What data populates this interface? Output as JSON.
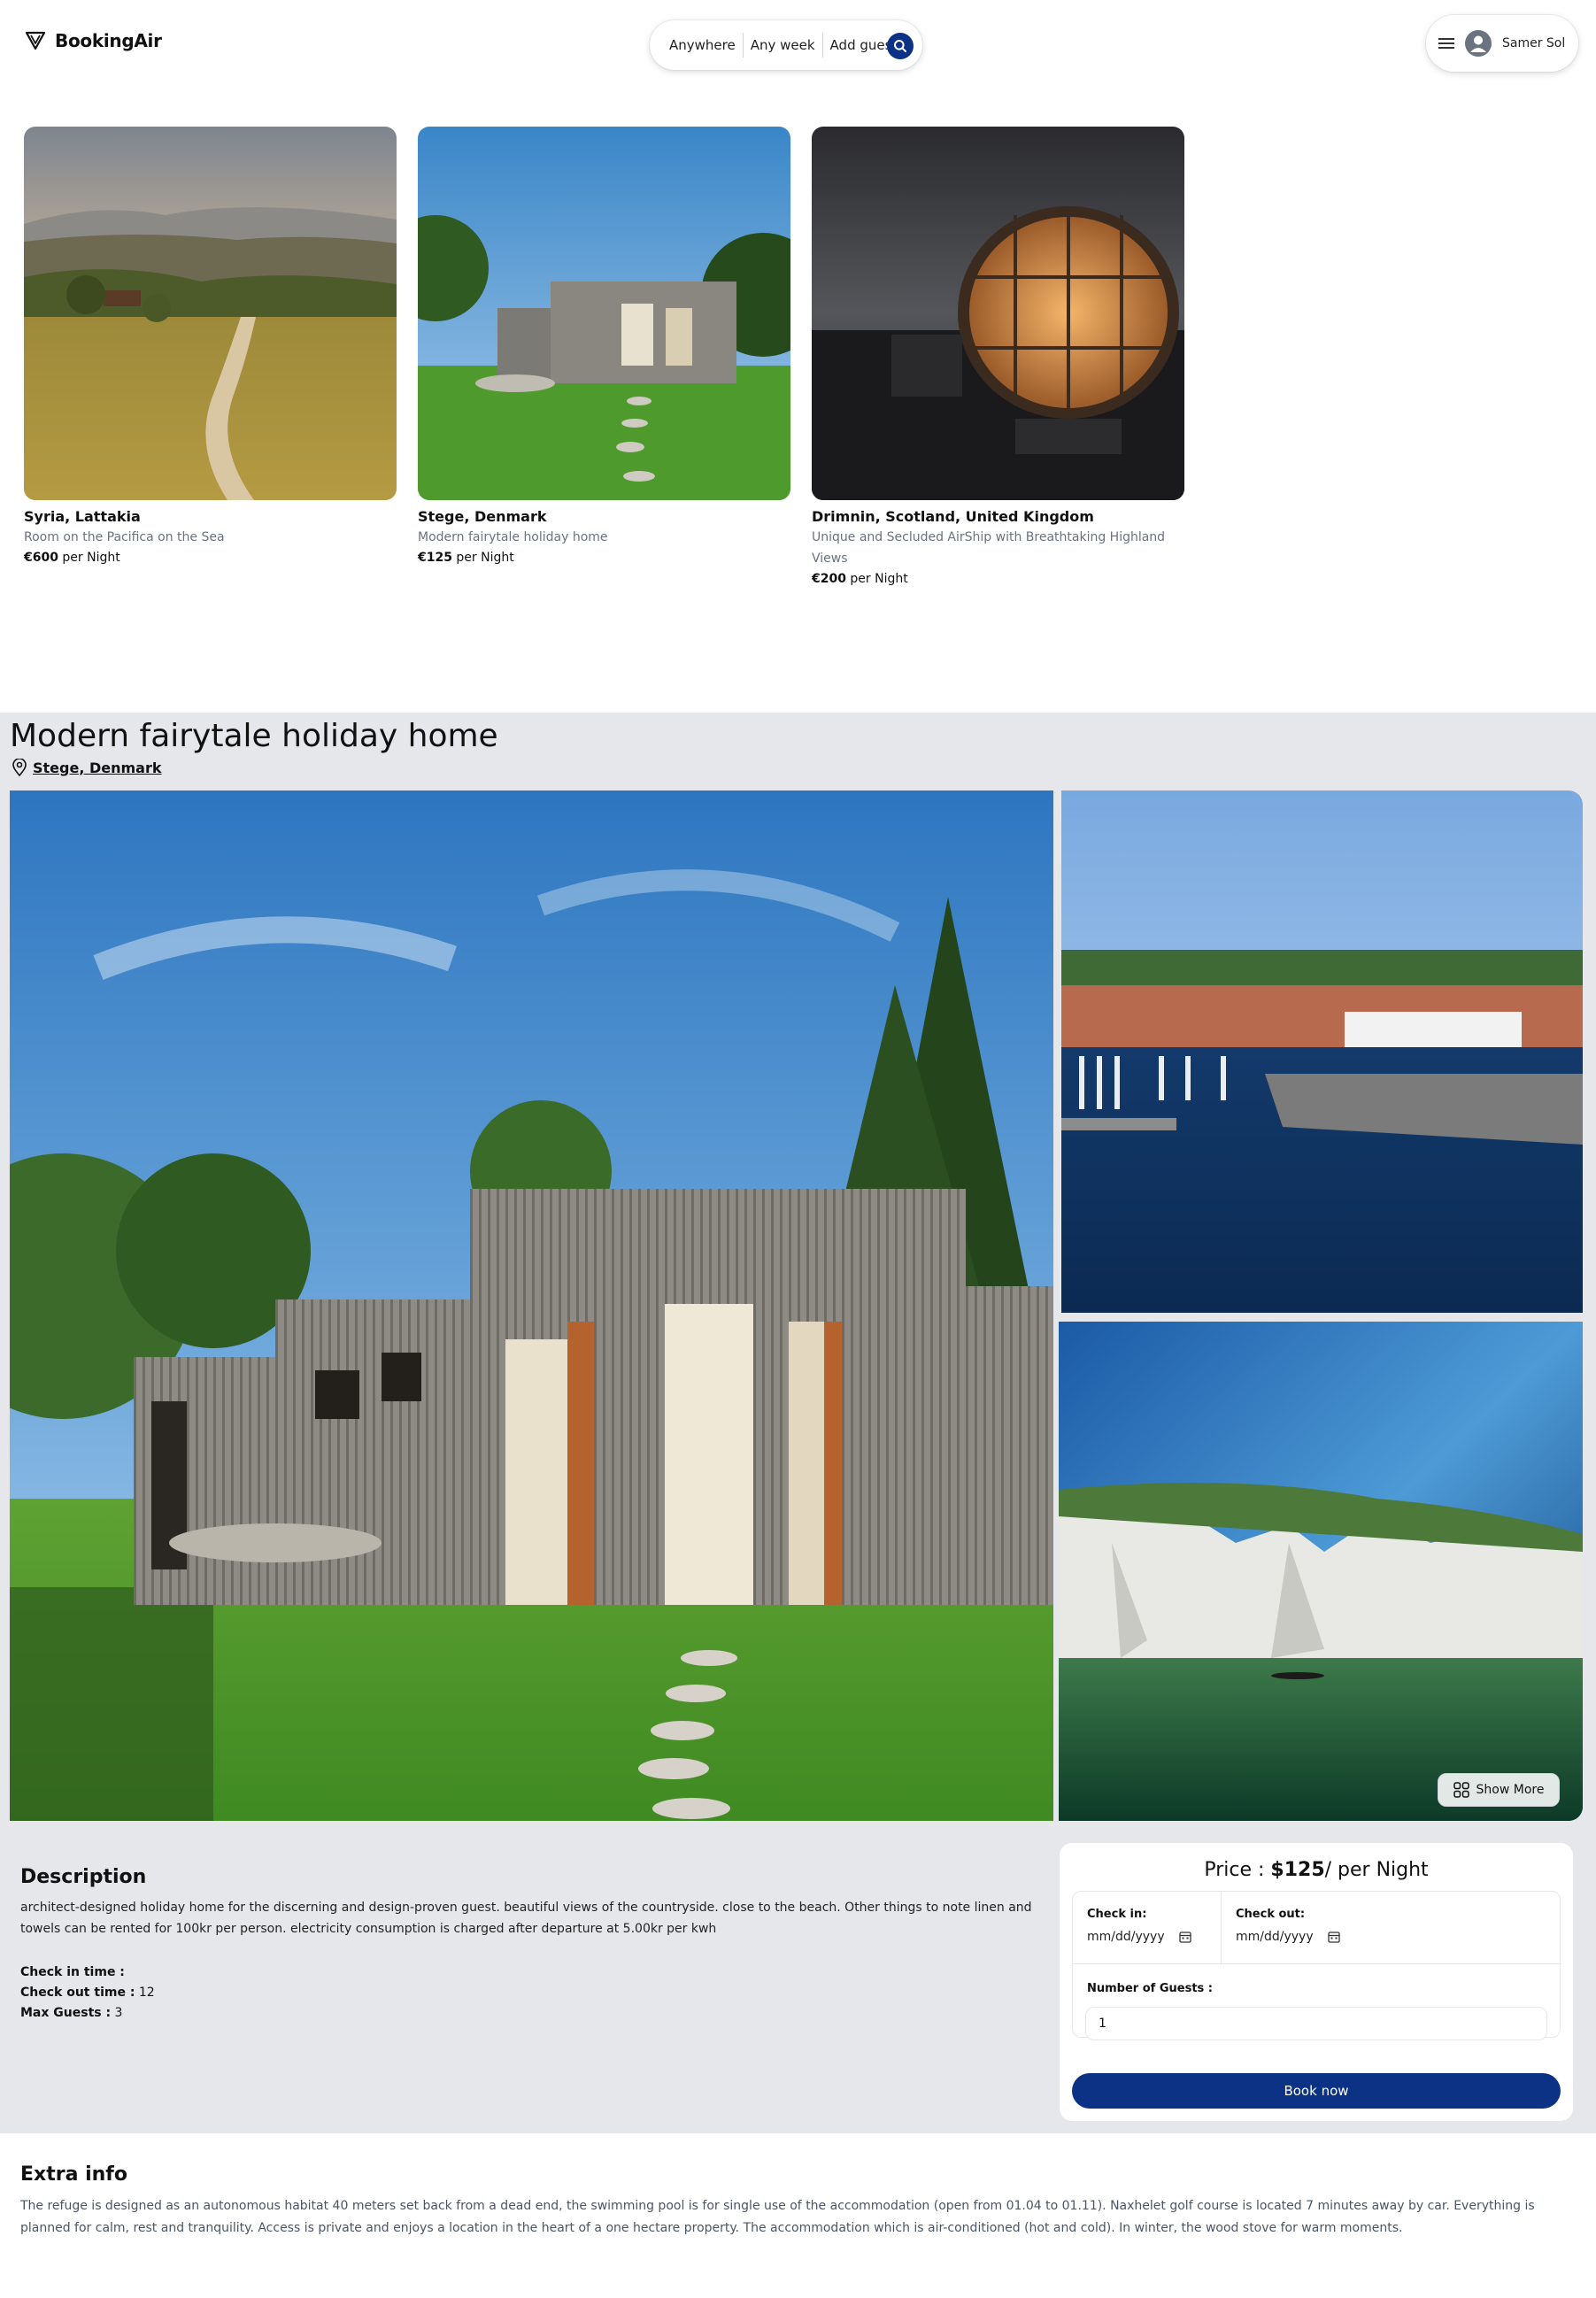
{
  "app": {
    "name": "BookingAir"
  },
  "header": {
    "search": {
      "where": "Anywhere",
      "when": "Any week",
      "guests": "Add guests"
    },
    "user": {
      "name": "Samer Sol"
    }
  },
  "listings": [
    {
      "title": "Syria, Lattakia",
      "subtitle": "Room on the Pacifica on the Sea",
      "price": "€600",
      "unit": "per Night"
    },
    {
      "title": "Stege, Denmark",
      "subtitle": "Modern fairytale holiday home",
      "price": "€125",
      "unit": "per Night"
    },
    {
      "title": "Drimnin, Scotland, United Kingdom",
      "subtitle": "Unique and Secluded AirShip with Breathtaking Highland Views",
      "price": "€200",
      "unit": "per Night"
    }
  ],
  "detail": {
    "title": "Modern fairytale holiday home",
    "location": "Stege, Denmark",
    "show_more": "Show More",
    "description_heading": "Description",
    "description": "architect-designed holiday home for the discerning and design-proven guest. beautiful views of the countryside. close to the beach. Other things to note linen and towels can be rented for 100kr per person. electricity consumption is charged after departure at 5.00kr per kwh",
    "check_in_label": "Check in time :",
    "check_in_value": "",
    "check_out_label": "Check out time :",
    "check_out_value": "12",
    "max_guests_label": "Max Guests :",
    "max_guests_value": "3"
  },
  "booking": {
    "price_prefix": "Price :",
    "price": "$125",
    "price_suffix": "/ per Night",
    "check_in_label": "Check in:",
    "check_in_placeholder": "mm/dd/yyyy",
    "check_out_label": "Check out:",
    "check_out_placeholder": "mm/dd/yyyy",
    "guests_label": "Number of Guests :",
    "guests_value": "1",
    "button": "Book now"
  },
  "extra": {
    "heading": "Extra info",
    "text": "The refuge is designed as an autonomous habitat 40 meters set back from a dead end, the swimming pool is for single use of the accommodation (open from 01.04 to 01.11). Naxhelet golf course is located 7 minutes away by car. Everything is planned for calm, rest and tranquility. Access is private and enjoys a location in the heart of a one hectare property. The accommodation which is air-conditioned (hot and cold). In winter, the wood stove for warm moments."
  },
  "colors": {
    "accent": "#0b3285",
    "section_bg": "#e5e7eb",
    "muted_text": "#6b7280"
  },
  "icons": [
    "logo-triangle-icon",
    "search-icon",
    "menu-icon",
    "user-avatar-icon",
    "location-pin-icon",
    "grid-icon",
    "calendar-icon"
  ]
}
